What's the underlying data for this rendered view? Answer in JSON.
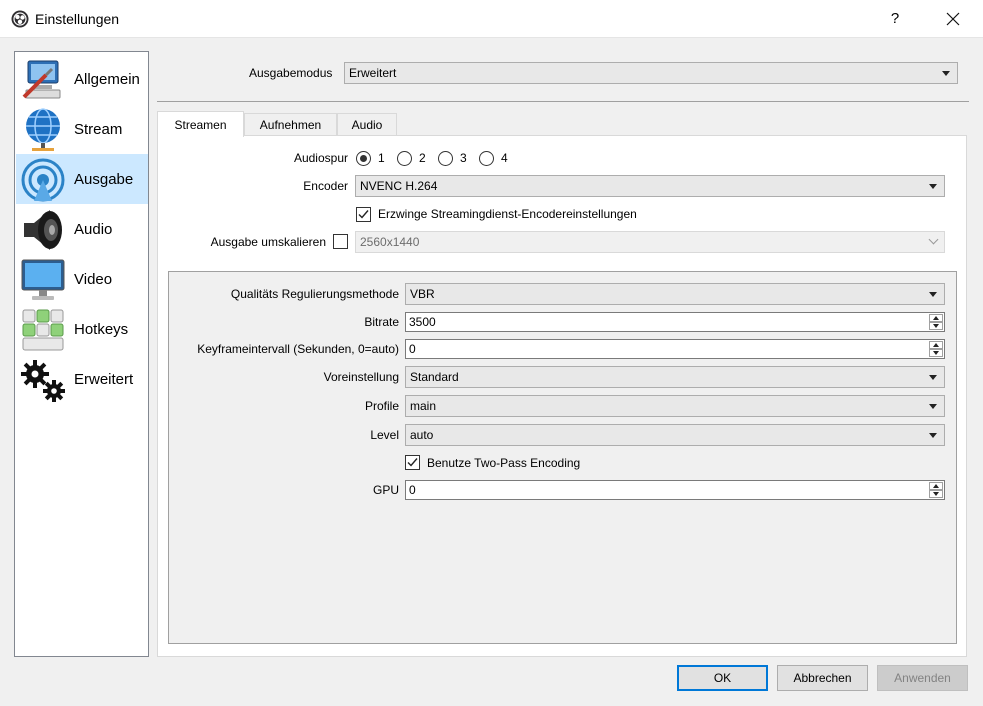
{
  "window": {
    "title": "Einstellungen",
    "help_glyph": "?"
  },
  "sidebar": {
    "items": [
      {
        "label": "Allgemein",
        "icon": "general-settings-icon"
      },
      {
        "label": "Stream",
        "icon": "stream-globe-icon"
      },
      {
        "label": "Ausgabe",
        "icon": "output-broadcast-icon",
        "selected": true
      },
      {
        "label": "Audio",
        "icon": "speaker-icon"
      },
      {
        "label": "Video",
        "icon": "monitor-icon"
      },
      {
        "label": "Hotkeys",
        "icon": "keyboard-icon"
      },
      {
        "label": "Erweitert",
        "icon": "gears-icon"
      }
    ]
  },
  "output_mode": {
    "label": "Ausgabemodus",
    "value": "Erweitert"
  },
  "tabs": [
    {
      "label": "Streamen",
      "active": true
    },
    {
      "label": "Aufnehmen"
    },
    {
      "label": "Audio"
    }
  ],
  "stream": {
    "audio_track": {
      "label": "Audiospur",
      "options": [
        "1",
        "2",
        "3",
        "4"
      ],
      "selected": "1"
    },
    "encoder": {
      "label": "Encoder",
      "value": "NVENC H.264"
    },
    "enforce": {
      "label": "Erzwinge Streamingdienst-Encodereinstellungen",
      "checked": true
    },
    "rescale": {
      "label": "Ausgabe umskalieren",
      "checked": false,
      "value": "2560x1440"
    }
  },
  "encoder_settings": {
    "rate_control": {
      "label": "Qualitäts Regulierungsmethode",
      "value": "VBR"
    },
    "bitrate": {
      "label": "Bitrate",
      "value": "3500"
    },
    "keyframe": {
      "label": "Keyframeintervall (Sekunden, 0=auto)",
      "value": "0"
    },
    "preset": {
      "label": "Voreinstellung",
      "value": "Standard"
    },
    "profile": {
      "label": "Profile",
      "value": "main"
    },
    "level": {
      "label": "Level",
      "value": "auto"
    },
    "two_pass": {
      "label": "Benutze Two-Pass Encoding",
      "checked": true
    },
    "gpu": {
      "label": "GPU",
      "value": "0"
    }
  },
  "buttons": {
    "ok": "OK",
    "cancel": "Abbrechen",
    "apply": "Anwenden"
  },
  "colors": {
    "selection": "#cce8ff",
    "default_button_border": "#0078d7"
  }
}
